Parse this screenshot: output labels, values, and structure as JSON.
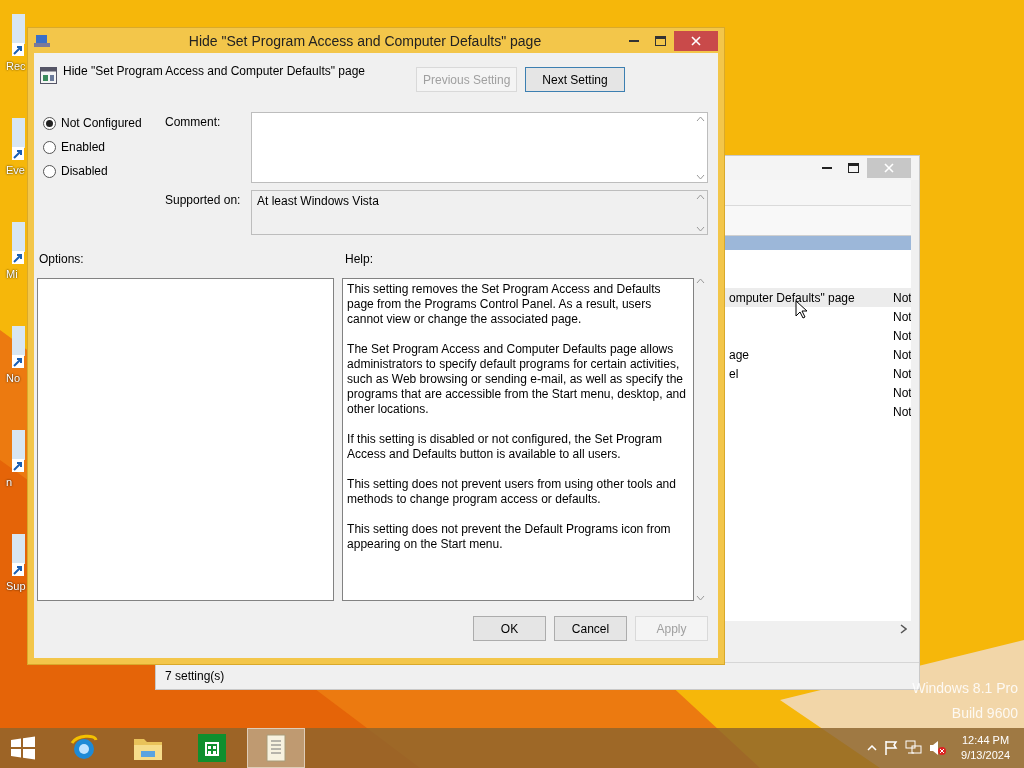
{
  "desktop_icons": [
    {
      "label": "Rec"
    },
    {
      "label": "Eve"
    },
    {
      "label": "Mi"
    },
    {
      "label": "No"
    },
    {
      "label": "n"
    },
    {
      "label": "Sup"
    }
  ],
  "background_window": {
    "rows": [
      {
        "name": "omputer Defaults\" page",
        "state": "Not",
        "selected": true
      },
      {
        "state": "Not",
        "selected": false
      },
      {
        "state": "Not",
        "selected": false
      },
      {
        "name": "age",
        "state": "Not",
        "selected": false
      },
      {
        "name": "el",
        "state": "Not",
        "selected": false
      },
      {
        "state": "Not",
        "selected": false
      },
      {
        "state": "Not",
        "selected": false
      }
    ],
    "status": "7 setting(s)"
  },
  "dialog": {
    "title": "Hide \"Set Program Access and Computer Defaults\" page",
    "setting_name": "Hide \"Set Program Access and Computer Defaults\" page",
    "nav_buttons": [
      {
        "label": "Previous Setting",
        "disabled": true
      },
      {
        "label": "Next Setting",
        "disabled": false
      }
    ],
    "options": [
      {
        "label": "Not Configured",
        "selected": true
      },
      {
        "label": "Enabled",
        "selected": false
      },
      {
        "label": "Disabled",
        "selected": false
      }
    ],
    "comment_label": "Comment:",
    "supported_label": "Supported on:",
    "supported_value": "At least Windows Vista",
    "options_label": "Options:",
    "help_label": "Help:",
    "help": [
      "This setting removes the Set Program Access and Defaults page from the Programs Control Panel.  As a result, users cannot view or change the associated page.",
      "The Set Program Access and Computer Defaults page allows administrators to specify default programs for certain activities, such as Web browsing or sending e-mail, as well as specify the programs that are accessible from the Start menu, desktop, and other locations.",
      "If this setting is disabled or not configured, the Set Program Access and Defaults button is available to all users.",
      "This setting does not prevent users from using other tools and methods to change program access or defaults.",
      "This setting does not prevent the Default Programs icon from appearing on the Start menu."
    ],
    "buttons": [
      {
        "label": "OK",
        "disabled": false
      },
      {
        "label": "Cancel",
        "disabled": false
      },
      {
        "label": "Apply",
        "disabled": true
      }
    ]
  },
  "os_edition": [
    "Windows 8.1 Pro",
    "Build 9600"
  ],
  "taskbar": {
    "apps": [
      {
        "kind": "browser",
        "active": false
      },
      {
        "kind": "folder",
        "active": false
      },
      {
        "kind": "store",
        "active": false
      },
      {
        "kind": "document",
        "active": true
      }
    ],
    "clock": {
      "time": "12:44 PM",
      "date": "9/13/2024"
    }
  }
}
